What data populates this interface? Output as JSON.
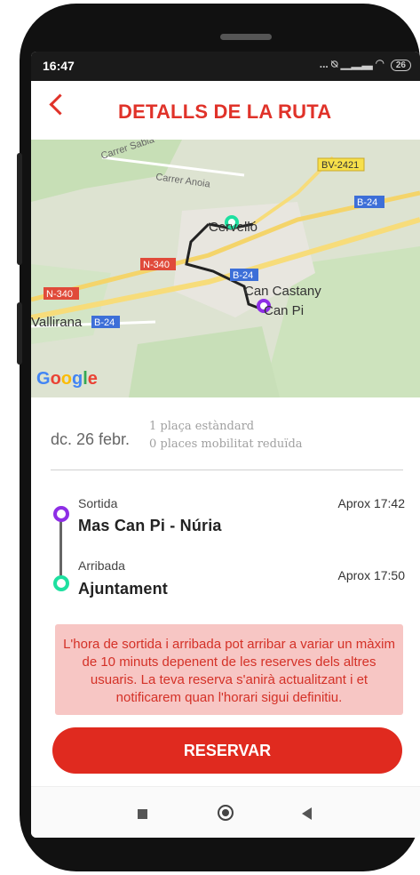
{
  "status_bar": {
    "time": "16:47",
    "icons": [
      "more-dots-icon",
      "no-notify-icon",
      "signal-icon",
      "wifi-icon",
      "battery-icon"
    ],
    "battery_level": "26",
    "dots": "..."
  },
  "header": {
    "back_icon": "chevron-left-icon",
    "title": "DETALLS DE LA RUTA"
  },
  "map": {
    "labels": {
      "carrer_sabia": "Carrer Sabia",
      "carrer_anoia": "Carrer Anoia",
      "bv2421": "BV-2421",
      "b24_a": "B-24",
      "b24_b": "B-24",
      "b24_c": "B-24",
      "n340_a": "N-340",
      "n340_b": "N-340",
      "cervello": "Cervelló",
      "can_castany": "Can Castany",
      "can_pi": "Can Pi",
      "vallirana": "Vallirana"
    },
    "google_logo": [
      "G",
      "o",
      "o",
      "g",
      "l",
      "e"
    ],
    "colors": {
      "route": "#222222",
      "origin_marker": "#1ee0a0",
      "destination_marker": "#8e2ee6",
      "road": "#f5d86e"
    }
  },
  "trip": {
    "date": "dc. 26 febr.",
    "standard_seats": "1 plaça estàndard",
    "reduced_mobility_seats": "0 places mobilitat reduïda"
  },
  "stops": {
    "departure": {
      "label": "Sortida",
      "name": "Mas Can Pi - Núria",
      "time": "Aprox 17:42",
      "color": "#8e2ee6"
    },
    "arrival": {
      "label": "Arribada",
      "name": "Ajuntament",
      "time": "Aprox 17:50",
      "color": "#1ee0a0"
    }
  },
  "notice": "L'hora de sortida i arribada pot arribar a variar un màxim de 10 minuts depenent de les reserves dels altres usuaris. La teva reserva s'anirà actualitzant i et notificarem quan l'horari sigui definitiu.",
  "reserve_button": "RESERVAR",
  "nav_bar": {
    "icons": [
      "recents-icon",
      "home-icon",
      "back-icon"
    ]
  },
  "brand_color": "#e03229"
}
